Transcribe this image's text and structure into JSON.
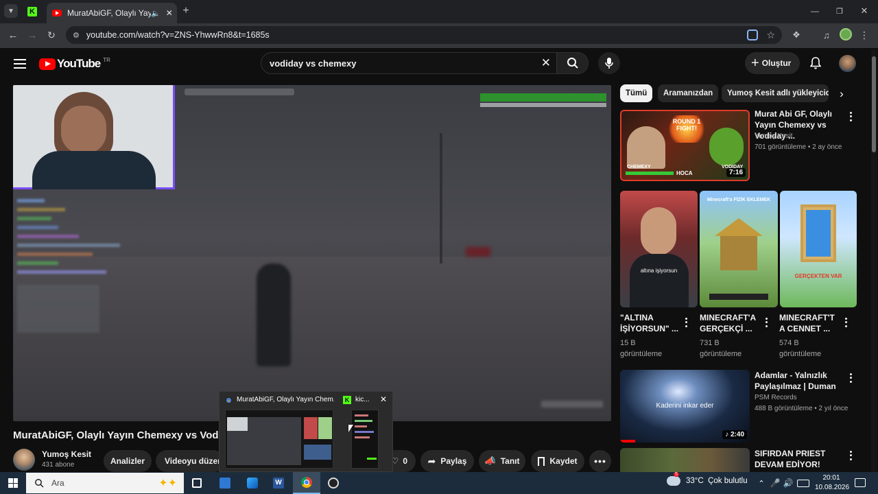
{
  "browser": {
    "tab_title": "MuratAbiGF, Olaylı Yayın Ch",
    "url": "youtube.com/watch?v=ZNS-YhwwRn8&t=1685s"
  },
  "youtube": {
    "logo_text": "YouTube",
    "region": "TR",
    "search_value": "vodiday vs chemexy",
    "create_label": "Oluştur"
  },
  "chips": [
    "Tümü",
    "Aramanızdan",
    "Yumoş Kesit adlı yükleyiciden"
  ],
  "video": {
    "title": "MuratAbiGF, Olaylı Yayın Chemexy vs Vodi",
    "channel": "Yumoş Kesit",
    "subs": "431 abone",
    "analyze": "Analizler",
    "edit": "Videoyu düzenle",
    "dislike_count": "0",
    "share": "Paylaş",
    "promote": "Tanıt",
    "save": "Kaydet"
  },
  "recommended": [
    {
      "title": "Murat Abi GF, Olaylı Yayın Chemexy vs Vodiday ...",
      "channel": "Yumoş Kesit",
      "meta": "701 görüntüleme • 2 ay önce",
      "duration": "7:16"
    },
    {
      "title": "Adamlar - Yalnızlık Paylaşılmaz | Duman",
      "channel": "PSM Records",
      "meta": "488 B görüntüleme • 2 yıl önce",
      "duration": "2:40",
      "overlay": "Kaderini inkar eder"
    },
    {
      "title": "SIFIRDAN PRIEST DEVAM EDİYOR!"
    }
  ],
  "shorts": [
    {
      "title": "\"ALTINA İŞİYORSUN\" ...",
      "views": "15 B",
      "views2": "görüntüleme",
      "caption": "altına işiyorsun"
    },
    {
      "title": "MINECRAFT'A GERÇEKÇİ ...",
      "views": "731 B",
      "views2": "görüntüleme",
      "caption": "Minecraft'a FİZİK EKLEMEK"
    },
    {
      "title": "MINECRAFT'T A CENNET ...",
      "views": "574 B",
      "views2": "görüntüleme",
      "caption": "GERÇEKTEN VAR"
    }
  ],
  "thumb1": {
    "round": "ROUND 1 FIGHT!",
    "left": "CHEMEXY",
    "right": "VODIDAY",
    "mid": "HOCA"
  },
  "popup": {
    "item1": "MuratAbiGF, Olaylı Yayın Chem...",
    "item2": "kic..."
  },
  "taskbar": {
    "search_placeholder": "Ara",
    "weather": "33°C  Çok bulutlu",
    "weather_badge": "5",
    "time": "20:01",
    "date": "10.08.2026"
  },
  "colors": {
    "youtube_red": "#ff0000",
    "kick_green": "#53fc18",
    "chrome_bg": "#202124"
  }
}
